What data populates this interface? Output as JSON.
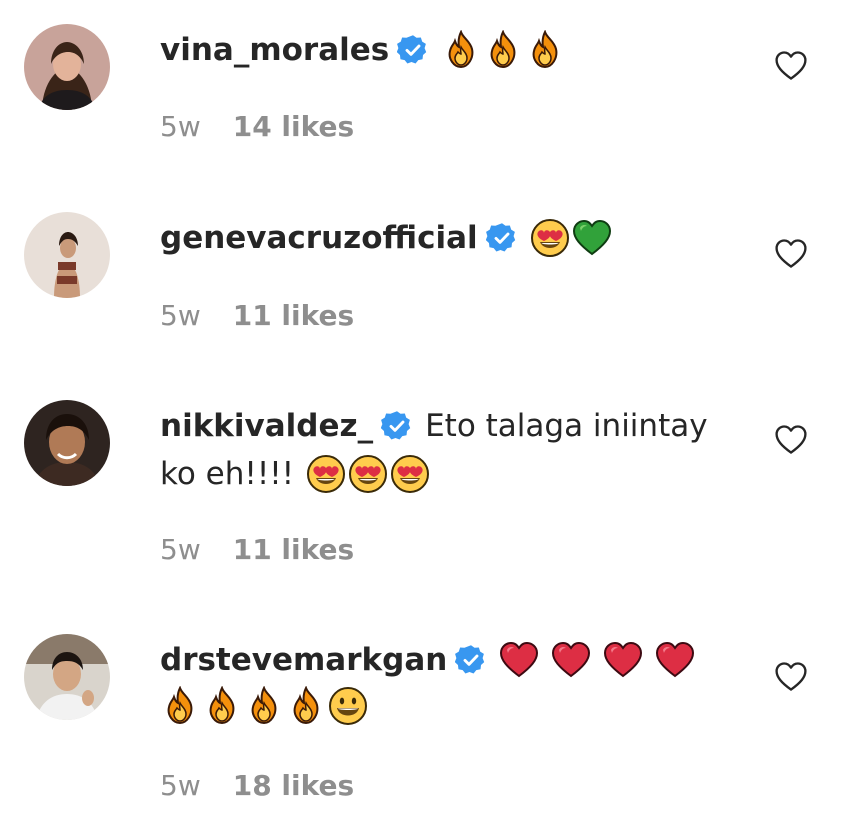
{
  "comments": [
    {
      "username": "vina_morales",
      "text": "",
      "emojis": [
        "fire",
        "fire",
        "fire"
      ],
      "time": "5w",
      "likes": "14 likes",
      "avatar_colors": {
        "bg": "#c8a39a",
        "skin": "#e3b39a",
        "hair": "#3a2418",
        "shirt": "#1e1a1c"
      }
    },
    {
      "username": "genevacruzofficial",
      "text": "",
      "emojis": [
        "heart-eyes",
        "green-heart"
      ],
      "time": "5w",
      "likes": "11 likes",
      "avatar_colors": {
        "bg": "#e8dfd8",
        "skin": "#c99a7a",
        "hair": "#2a1a12",
        "shirt": "#7a3a2a"
      }
    },
    {
      "username": "nikkivaldez_",
      "text_line1": "Eto talaga iniintay",
      "text_line2": "ko eh!!!!",
      "emojis": [
        "heart-eyes",
        "heart-eyes",
        "heart-eyes"
      ],
      "time": "5w",
      "likes": "11 likes",
      "avatar_colors": {
        "bg": "#2e2420",
        "skin": "#b07a56",
        "hair": "#1a100b",
        "shirt": "#3d2a22"
      }
    },
    {
      "username": "drstevemarkgan",
      "text": "",
      "emojis_line1": [
        "red-heart",
        "red-heart",
        "red-heart",
        "red-heart"
      ],
      "emojis_line2": [
        "fire",
        "fire",
        "fire",
        "fire",
        "grinning"
      ],
      "time": "5w",
      "likes": "18 likes",
      "avatar_colors": {
        "bg": "#d9d4cc",
        "skin": "#d3a684",
        "hair": "#1c1410",
        "shirt": "#f2f2f2"
      }
    }
  ],
  "colors": {
    "verified": "#3897f0",
    "meta_text": "#8e8e8e",
    "username_text": "#262626"
  },
  "icons": {
    "verified": "verified-badge-icon",
    "like": "heart-outline-icon"
  }
}
